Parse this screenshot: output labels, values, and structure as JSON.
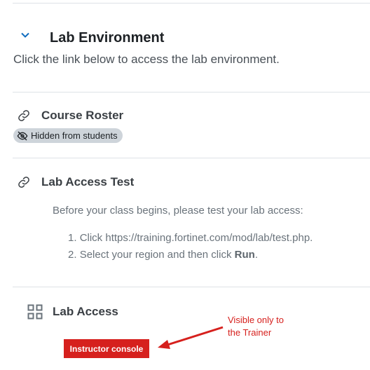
{
  "section": {
    "title": "Lab Environment",
    "summary": "Click the link below to access the lab environment."
  },
  "activities": [
    {
      "title": "Course Roster",
      "icon": "link-icon",
      "badge": "Hidden from students"
    },
    {
      "title": "Lab Access Test",
      "icon": "link-icon",
      "description": "Before your class begins, please test your lab access:",
      "steps": [
        {
          "number": "1.",
          "text": "Click https://training.fortinet.com/mod/lab/test.php."
        },
        {
          "number": "2.",
          "text_before": "Select your region and then click ",
          "bold": "Run",
          "text_after": "."
        }
      ]
    },
    {
      "title": "Lab Access",
      "icon": "apps-grid-icon",
      "button_label": "Instructor console"
    }
  ],
  "annotation": {
    "line1": "Visible only to",
    "line2": "the Trainer",
    "color": "#d6201d"
  },
  "colors": {
    "accent": "#0f6cbf",
    "button": "#d6201d",
    "badge_bg": "#ced4da"
  }
}
